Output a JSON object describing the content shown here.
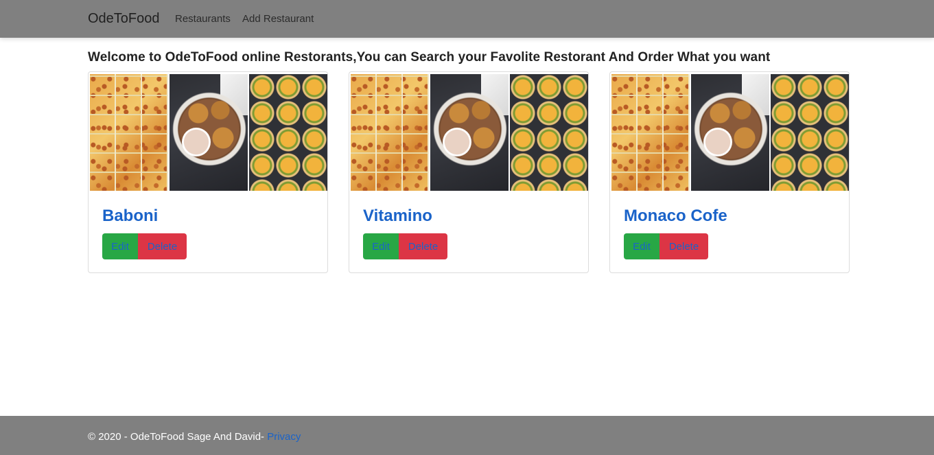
{
  "navbar": {
    "brand": "OdeToFood",
    "links": [
      {
        "label": "Restaurants"
      },
      {
        "label": "Add Restaurant"
      }
    ]
  },
  "main": {
    "welcome": "Welcome to OdeToFood online Restorants,You can Search your Favolite Restorant And Order What you want",
    "restaurants": [
      {
        "name": "Baboni",
        "edit_label": "Edit",
        "delete_label": "Delete"
      },
      {
        "name": "Vitamino",
        "edit_label": "Edit",
        "delete_label": "Delete"
      },
      {
        "name": "Monaco Cofe",
        "edit_label": "Edit",
        "delete_label": "Delete"
      }
    ]
  },
  "footer": {
    "text": "© 2020 - OdeToFood Sage And David-",
    "privacy_label": "Privacy"
  },
  "colors": {
    "navbar_bg": "#808080",
    "title_blue": "#1a63c9",
    "edit_green": "#28a745",
    "delete_red": "#dc3545"
  }
}
